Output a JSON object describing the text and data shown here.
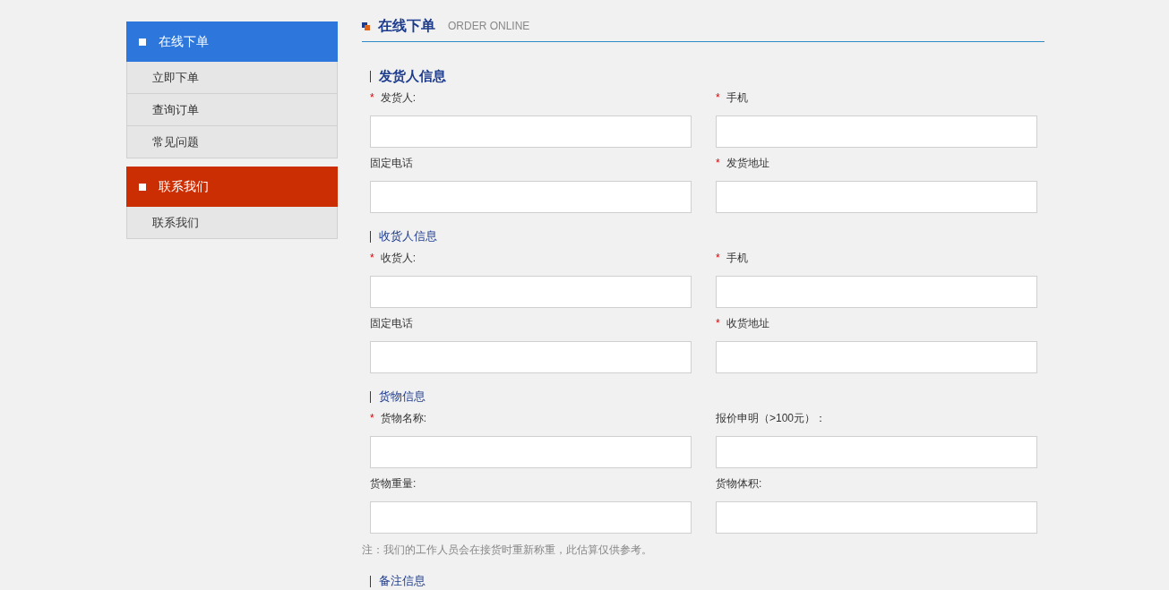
{
  "sidebar": {
    "groups": [
      {
        "title": "在线下单",
        "color": "#2d77dc",
        "items": [
          {
            "label": "立即下单"
          },
          {
            "label": "查询订单"
          },
          {
            "label": "常见问题"
          }
        ]
      },
      {
        "title": "联系我们",
        "color": "#cc2e04",
        "items": [
          {
            "label": "联系我们"
          }
        ]
      }
    ]
  },
  "page_header": {
    "title": "在线下单",
    "subtitle": "ORDER ONLINE"
  },
  "sections": [
    {
      "title": "发货人信息",
      "bold": true,
      "fields": [
        {
          "label": "发货人:",
          "required_mark": "*"
        },
        {
          "label": "手机",
          "required_mark": "*"
        },
        {
          "label": "固定电话"
        },
        {
          "label": "发货地址",
          "required_mark": "*"
        }
      ]
    },
    {
      "title": "收货人信息",
      "bold": false,
      "fields": [
        {
          "label": "收货人:",
          "required_mark": "*"
        },
        {
          "label": "手机",
          "required_mark": "*"
        },
        {
          "label": "固定电话"
        },
        {
          "label": "收货地址",
          "required_mark": "*"
        }
      ]
    },
    {
      "title": "货物信息",
      "bold": false,
      "fields": [
        {
          "label": "货物名称:",
          "required_mark": "*"
        },
        {
          "label": "报价申明（>100元）："
        },
        {
          "label": "货物重量:"
        },
        {
          "label": "货物体积:"
        }
      ],
      "note": "注：我们的工作人员会在接货时重新称重，此估算仅供参考。"
    },
    {
      "title": "备注信息",
      "bold": false
    }
  ]
}
